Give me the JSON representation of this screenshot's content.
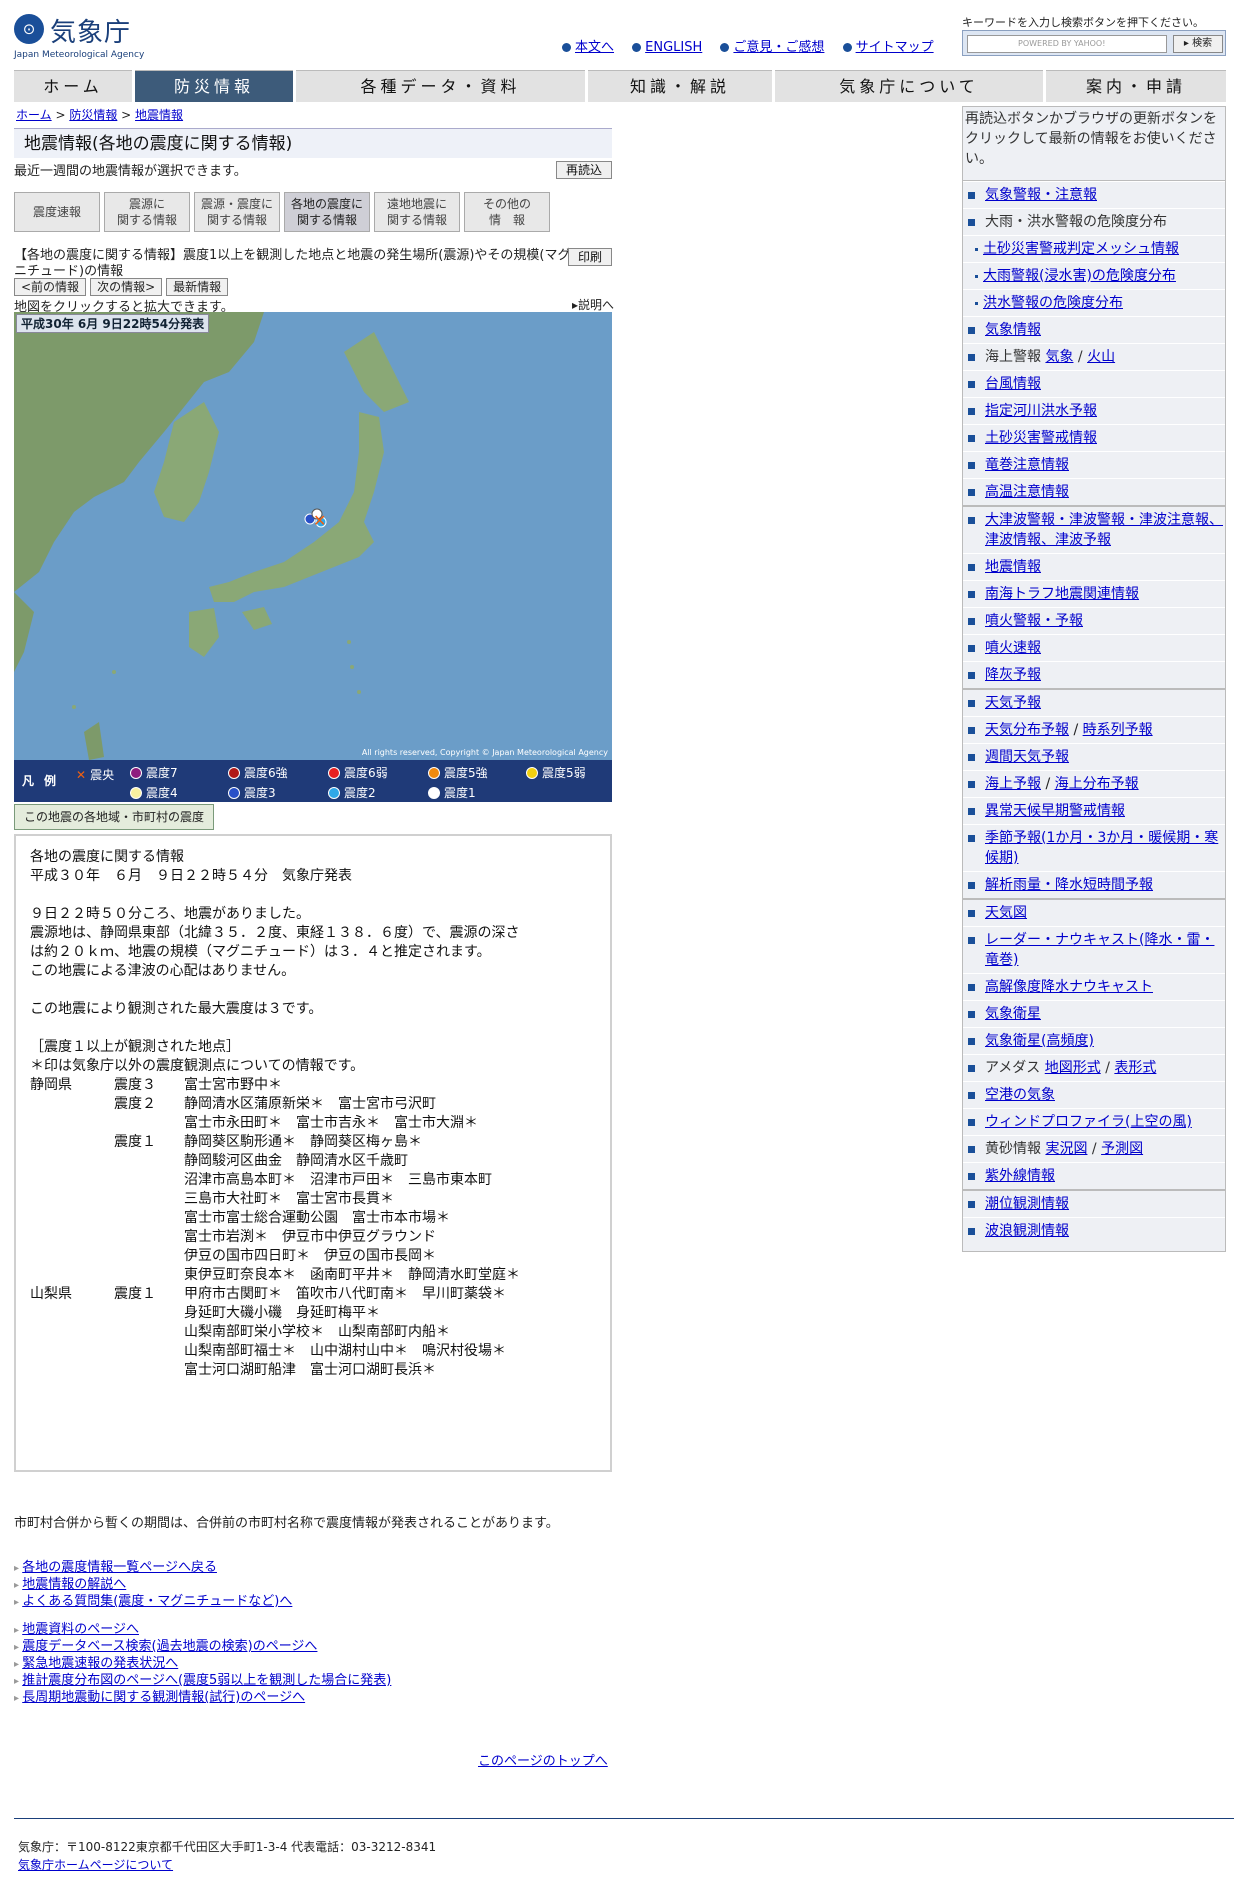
{
  "header": {
    "logo_text": "気象庁",
    "logo_sub": "Japan Meteorological Agency",
    "logo_mark": "JMA",
    "top_links": [
      "本文へ",
      "ENGLISH",
      "ご意見・ご感想",
      "サイトマップ"
    ],
    "search_hint": "キーワードを入力し検索ボタンを押下ください。",
    "search_powered": "POWERED BY YAHOO!",
    "search_button": "▸ 検索"
  },
  "gnav": [
    "ホーム",
    "防災情報",
    "各種データ・資料",
    "知識・解説",
    "気象庁について",
    "案内・申請"
  ],
  "breadcrumb": [
    "ホーム",
    "防災情報",
    "地震情報"
  ],
  "title": "地震情報(各地の震度に関する情報)",
  "subtitle": "最近一週間の地震情報が選択できます。",
  "reload_button": "再読込",
  "tabs": [
    [
      "震度速報",
      ""
    ],
    [
      "震源に",
      "関する情報"
    ],
    [
      "震源・震度に",
      "関する情報"
    ],
    [
      "各地の震度に",
      "関する情報"
    ],
    [
      "遠地地震に",
      "関する情報"
    ],
    [
      "その他の",
      "情　報"
    ]
  ],
  "desc": "【各地の震度に関する情報】震度1以上を観測した地点と地震の発生場所(震源)やその規模(マグニチュード)の情報",
  "print_button": "印刷",
  "nav_buttons": [
    "<前の情報",
    "次の情報>",
    "最新情報"
  ],
  "map_hint": "地図をクリックすると拡大できます。",
  "explain_link": "説明へ",
  "map_label": "平成30年 6月 9日22時54分発表",
  "map_copyright": "All rights reserved, Copyright © Japan Meteorological Agency",
  "legend": {
    "title": "凡例",
    "epicenter": "震央",
    "items": [
      [
        "震度7",
        "#8e1d7e"
      ],
      [
        "震度6強",
        "#b01818"
      ],
      [
        "震度6弱",
        "#e82020"
      ],
      [
        "震度5強",
        "#f08a10"
      ],
      [
        "震度5弱",
        "#f2d010"
      ],
      [
        "震度4",
        "#f7f0a0"
      ],
      [
        "震度3",
        "#2850c8"
      ],
      [
        "震度2",
        "#30a8e8"
      ],
      [
        "震度1",
        "#ffffff"
      ]
    ]
  },
  "quake_tab": "この地震の各地域・市町村の震度",
  "report": "各地の震度に関する情報\n平成３０年　６月　９日２２時５４分　気象庁発表\n\n９日２２時５０分ころ、地震がありました。\n震源地は、静岡県東部（北緯３５．２度、東経１３８．６度）で、震源の深さ\nは約２０ｋｍ、地震の規模（マグニチュード）は３．４と推定されます。\nこの地震による津波の心配はありません。\n\nこの地震により観測された最大震度は３です。\n\n［震度１以上が観測された地点］\n＊印は気象庁以外の震度観測点についての情報です。\n静岡県　　　震度３　　富士宮市野中＊\n　　　　　　震度２　　静岡清水区蒲原新栄＊　富士宮市弓沢町\n　　　　　　　　　　　富士市永田町＊　富士市吉永＊　富士市大淵＊\n　　　　　　震度１　　静岡葵区駒形通＊　静岡葵区梅ヶ島＊\n　　　　　　　　　　　静岡駿河区曲金　静岡清水区千歳町\n　　　　　　　　　　　沼津市高島本町＊　沼津市戸田＊　三島市東本町\n　　　　　　　　　　　三島市大社町＊　富士宮市長貫＊\n　　　　　　　　　　　富士市富士総合運動公園　富士市本市場＊\n　　　　　　　　　　　富士市岩渕＊　伊豆市中伊豆グラウンド\n　　　　　　　　　　　伊豆の国市四日町＊　伊豆の国市長岡＊\n　　　　　　　　　　　東伊豆町奈良本＊　函南町平井＊　静岡清水町堂庭＊\n山梨県　　　震度１　　甲府市古関町＊　笛吹市八代町南＊　早川町薬袋＊\n　　　　　　　　　　　身延町大磯小磯　身延町梅平＊\n　　　　　　　　　　　山梨南部町栄小学校＊　山梨南部町内船＊\n　　　　　　　　　　　山梨南部町福士＊　山中湖村山中＊　鳴沢村役場＊\n　　　　　　　　　　　富士河口湖町船津　富士河口湖町長浜＊",
  "note": "市町村合併から暫くの期間は、合併前の市町村名称で震度情報が発表されることがあります。",
  "links1": [
    "各地の震度情報一覧ページへ戻る",
    "地震情報の解説へ",
    "よくある質問集(震度・マグニチュードなど)へ"
  ],
  "links2": [
    "地震資料のページへ",
    "震度データベース検索(過去地震の検索)のページへ",
    "緊急地震速報の発表状況へ",
    "推計震度分布図のページへ(震度5弱以上を観測した場合に発表)",
    "長周期地震動に関する観測情報(試行)のページへ"
  ],
  "totop": "このページのトップへ",
  "footer": {
    "address": "気象庁：〒100-8122東京都千代田区大手町1-3-4 代表電話：03-3212-8341",
    "about": "気象庁ホームページについて"
  },
  "side": {
    "note": "再読込ボタンかブラウザの更新ボタンをクリックして最新の情報をお使いください。"
  }
}
